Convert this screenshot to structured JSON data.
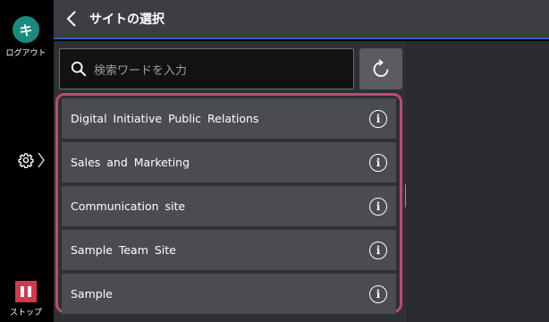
{
  "rail": {
    "logout_glyph": "キ",
    "logout_label": "ログアウト",
    "stop_label": "ストップ"
  },
  "header": {
    "title": "サイトの選択"
  },
  "search": {
    "placeholder": "検索ワードを入力"
  },
  "sites": [
    {
      "label": "Digital Initiative Public Relations",
      "info_glyph": "i"
    },
    {
      "label": "Sales and Marketing",
      "info_glyph": "i"
    },
    {
      "label": "Communication site",
      "info_glyph": "i"
    },
    {
      "label": "Sample Team Site",
      "info_glyph": "i"
    },
    {
      "label": "Sample",
      "info_glyph": "i"
    }
  ],
  "colors": {
    "accent_blue": "#2b64c0",
    "highlight_frame": "#c04a74",
    "logout_green": "#1a8a7c",
    "stop_red": "#d03a4c"
  }
}
